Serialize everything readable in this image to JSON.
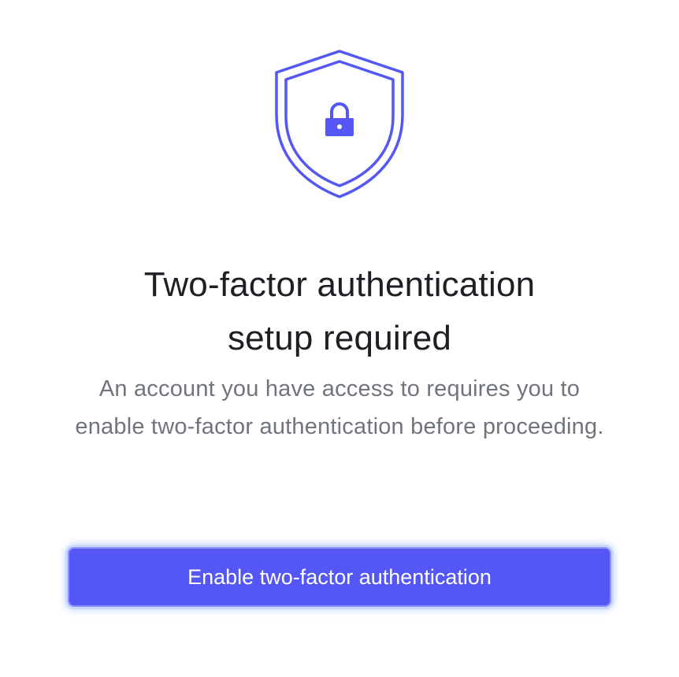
{
  "icon": {
    "shield": "shield-icon",
    "lock": "lock-icon",
    "accent_color": "#5457f4"
  },
  "heading": {
    "line1": "Two-factor authentication",
    "line2": "setup required"
  },
  "description": "An account you have access to requires you to enable two-factor authentication before proceeding.",
  "actions": {
    "enable_label": "Enable two-factor authentication"
  }
}
